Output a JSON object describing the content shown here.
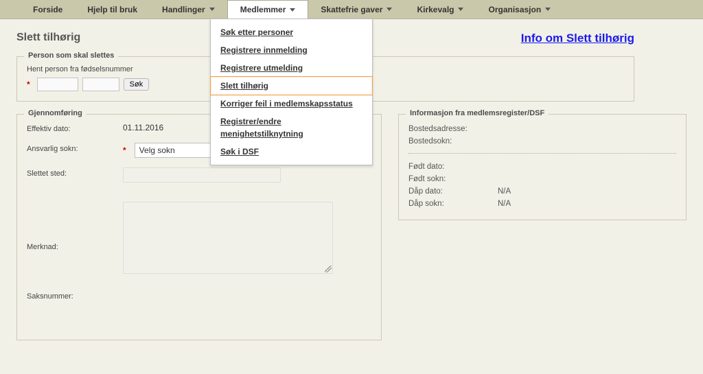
{
  "nav": {
    "items": [
      {
        "label": "Forside",
        "caret": false
      },
      {
        "label": "Hjelp til bruk",
        "caret": false
      },
      {
        "label": "Handlinger",
        "caret": true
      },
      {
        "label": "Medlemmer",
        "caret": true,
        "active": true
      },
      {
        "label": "Skattefrie gaver",
        "caret": true
      },
      {
        "label": "Kirkevalg",
        "caret": true
      },
      {
        "label": "Organisasjon",
        "caret": true
      }
    ]
  },
  "dropdown": {
    "items": [
      {
        "label": "Søk etter personer"
      },
      {
        "label": "Registrere innmelding"
      },
      {
        "label": "Registrere utmelding"
      },
      {
        "label": "Slett tilhørig",
        "selected": true
      },
      {
        "label": "Korriger feil i medlemskapsstatus"
      },
      {
        "label": "Registrer/endre menighetstilknytning"
      },
      {
        "label": "Søk i DSF"
      }
    ]
  },
  "page": {
    "title": "Slett tilhørig",
    "info_link": "Info om Slett tilhørig"
  },
  "person_box": {
    "legend": "Person som skal slettes",
    "label": "Hent person fra fødselsnummer",
    "input1": "",
    "input2": "",
    "search_btn": "Søk"
  },
  "gjennom": {
    "legend": "Gjennomføring",
    "eff_label": "Effektiv dato:",
    "eff_value": "01.11.2016",
    "sokn_label": "Ansvarlig sokn:",
    "sokn_selected": "Velg sokn",
    "sted_label": "Slettet sted:",
    "sted_value": "",
    "merk_label": "Merknad:",
    "merk_value": "",
    "saks_label": "Saksnummer:",
    "saks_value": ""
  },
  "info": {
    "legend": "Informasjon fra medlemsregister/DSF",
    "bosted_adr_label": "Bostedsadresse:",
    "bosted_adr_value": "",
    "bosted_sokn_label": "Bostedsokn:",
    "bosted_sokn_value": "",
    "fodt_dato_label": "Født dato:",
    "fodt_dato_value": "",
    "fodt_sokn_label": "Født sokn:",
    "fodt_sokn_value": "",
    "daap_dato_label": "Dåp dato:",
    "daap_dato_value": "N/A",
    "daap_sokn_label": "Dåp sokn:",
    "daap_sokn_value": "N/A"
  }
}
